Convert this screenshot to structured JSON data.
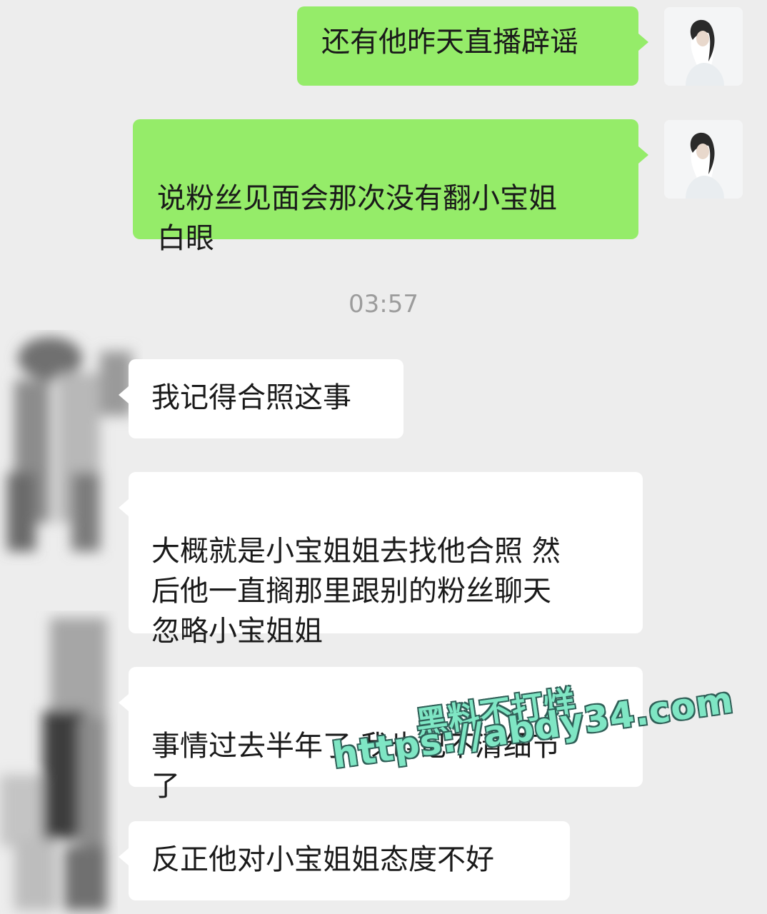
{
  "messages": [
    {
      "sender": "self",
      "text": "还有他昨天直播辟谣"
    },
    {
      "sender": "self",
      "text": "说粉丝见面会那次没有翻小宝姐\n白眼"
    },
    {
      "sender": "other",
      "text": "我记得合照这事"
    },
    {
      "sender": "other",
      "text": "大概就是小宝姐姐去找他合照 然\n后他一直搁那里跟别的粉丝聊天\n忽略小宝姐姐"
    },
    {
      "sender": "other",
      "text": "事情过去半年了 我也记不清细节\n了"
    },
    {
      "sender": "other",
      "text": "反正他对小宝姐姐态度不好"
    }
  ],
  "timestamp": "03:57",
  "watermark": {
    "line1": "黑料不打烊",
    "line2": "https://abdy34.com"
  },
  "colors": {
    "background": "#ededed",
    "outgoing_bubble": "#95ec69",
    "incoming_bubble": "#ffffff",
    "timestamp": "#9c9c9c"
  }
}
